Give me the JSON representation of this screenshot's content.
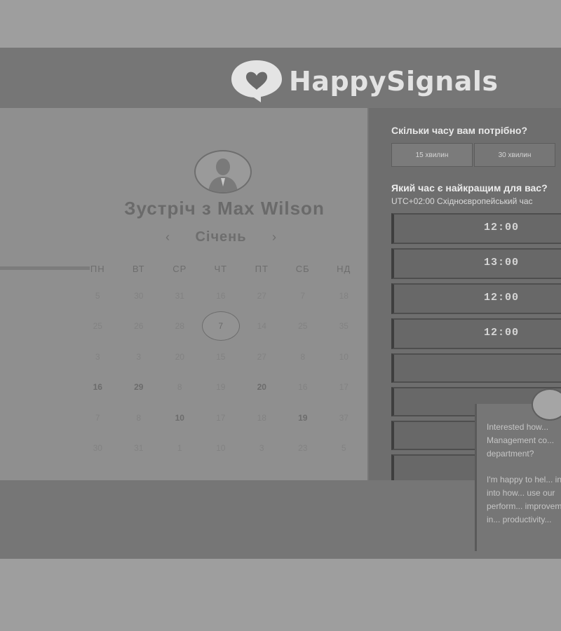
{
  "brand": {
    "name": "HappySignals"
  },
  "host": {
    "title": "Зустріч з Max Wilson"
  },
  "calendar": {
    "month": "Січень",
    "prev": "‹",
    "next": "›",
    "weekdays": [
      "ПН",
      "ВТ",
      "СР",
      "ЧТ",
      "ПТ",
      "СБ",
      "НД"
    ],
    "weeks": [
      [
        {
          "d": "5",
          "bold": false
        },
        {
          "d": "30",
          "bold": false
        },
        {
          "d": "31",
          "bold": false
        },
        {
          "d": "16",
          "bold": false
        },
        {
          "d": "27",
          "bold": false
        },
        {
          "d": "7",
          "bold": false
        },
        {
          "d": "18",
          "bold": false
        }
      ],
      [
        {
          "d": "25",
          "bold": false
        },
        {
          "d": "26",
          "bold": false
        },
        {
          "d": "28",
          "bold": false
        },
        {
          "d": "7",
          "bold": false,
          "selected": true
        },
        {
          "d": "14",
          "bold": false
        },
        {
          "d": "25",
          "bold": false
        },
        {
          "d": "35",
          "bold": false
        }
      ],
      [
        {
          "d": "3",
          "bold": false
        },
        {
          "d": "3",
          "bold": false
        },
        {
          "d": "20",
          "bold": false
        },
        {
          "d": "15",
          "bold": false
        },
        {
          "d": "27",
          "bold": false
        },
        {
          "d": "8",
          "bold": false
        },
        {
          "d": "10",
          "bold": false
        }
      ],
      [
        {
          "d": "16",
          "bold": true
        },
        {
          "d": "29",
          "bold": true
        },
        {
          "d": "8",
          "bold": false
        },
        {
          "d": "19",
          "bold": false
        },
        {
          "d": "20",
          "bold": true
        },
        {
          "d": "16",
          "bold": false
        },
        {
          "d": "17",
          "bold": false
        }
      ],
      [
        {
          "d": "7",
          "bold": false
        },
        {
          "d": "8",
          "bold": false
        },
        {
          "d": "10",
          "bold": true
        },
        {
          "d": "17",
          "bold": false
        },
        {
          "d": "18",
          "bold": false
        },
        {
          "d": "19",
          "bold": true
        },
        {
          "d": "37",
          "bold": false
        }
      ],
      [
        {
          "d": "30",
          "bold": false
        },
        {
          "d": "31",
          "bold": false
        },
        {
          "d": "1",
          "bold": false
        },
        {
          "d": "10",
          "bold": false
        },
        {
          "d": "3",
          "bold": false
        },
        {
          "d": "23",
          "bold": false
        },
        {
          "d": "5",
          "bold": false
        }
      ]
    ]
  },
  "scheduler": {
    "duration_question": "Скільки часу вам потрібно?",
    "durations": [
      "15 хвилин",
      "30 хвилин"
    ],
    "time_question": "Який час є найкращим для вас?",
    "timezone": "UTC+02:00 Східноєвропейський час",
    "slots": [
      "12:00",
      "13:00",
      "12:00",
      "12:00",
      "",
      "",
      "",
      ""
    ]
  },
  "chat": {
    "message_1": "Interested how... Management co... department?",
    "message_2": "I'm happy to hel... insight into how... use our perform... improvement in... productivity..."
  }
}
